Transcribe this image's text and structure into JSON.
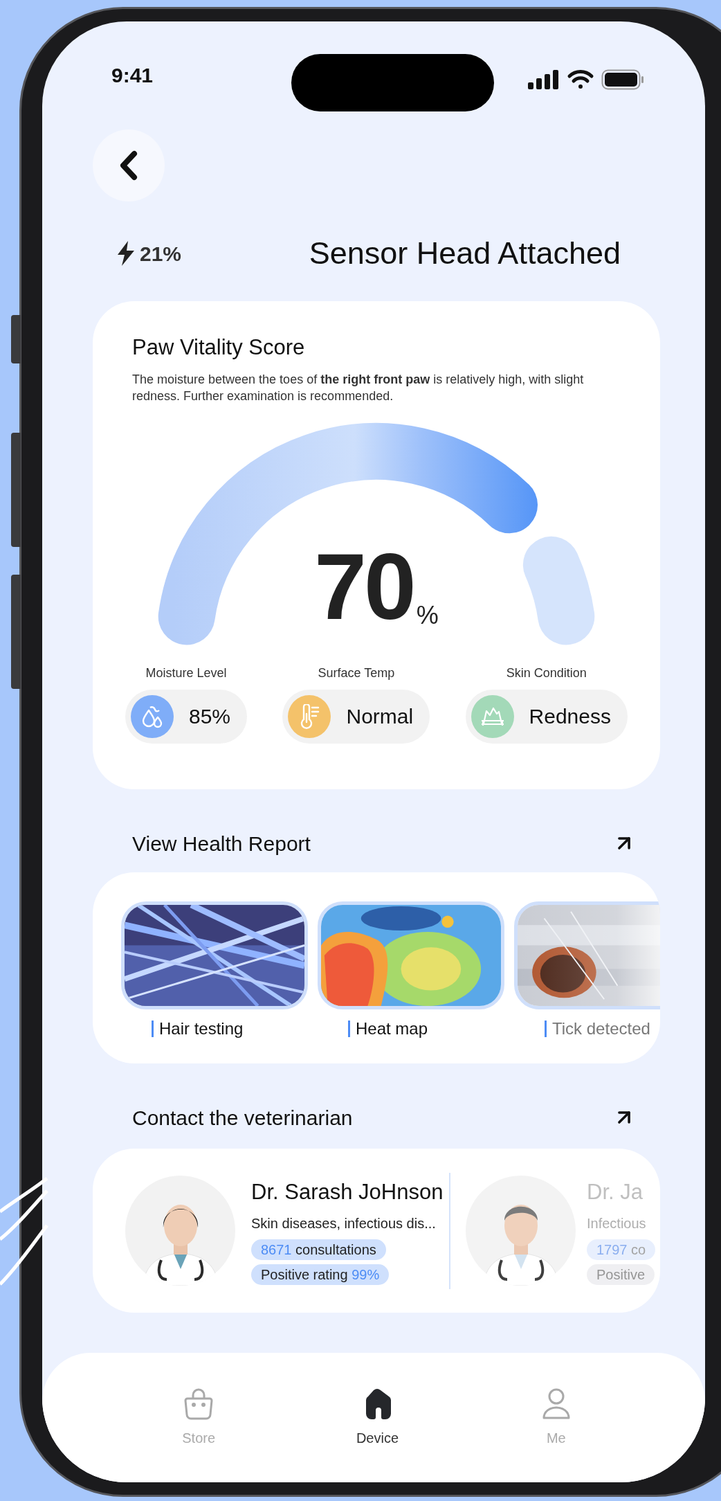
{
  "status_bar": {
    "time": "9:41"
  },
  "header": {
    "battery": "21%",
    "title": "Sensor Head Attached"
  },
  "score_card": {
    "title": "Paw Vitality Score",
    "description": "The moisture between the toes of **the right front paw** is relatively high, with slight redness. Further examination is recommended.",
    "gauge": {
      "level": 0.85,
      "value": "70",
      "unit": "%"
    },
    "metrics": [
      {
        "kind": "moisture",
        "label": "Moisture Level",
        "value": "85%",
        "color": "#7fadf8"
      },
      {
        "kind": "temperature",
        "label": "Surface Temp",
        "value": "Normal",
        "color": "#f4c26a"
      },
      {
        "kind": "skin",
        "label": "Skin Condition",
        "value": "Redness",
        "color": "#a3d9b8"
      }
    ]
  },
  "reports": {
    "title": "View Health Report",
    "items": [
      {
        "label": "Hair testing",
        "kind": "picture"
      },
      {
        "label": "Heat map",
        "kind": "picture"
      },
      {
        "label": "Tick detected",
        "kind": "picture"
      }
    ]
  },
  "vets": {
    "title": "Contact the veterinarian",
    "doctors": [
      {
        "name": "Dr. Sarash JoHnson",
        "specialty": "Skin diseases, infectious dis...",
        "count": "8671",
        "count_label": "consultations",
        "rating_label": "Positive rating",
        "rating_value": "99%",
        "faded": false
      },
      {
        "name": "Dr. Ja",
        "specialty": "Infectious",
        "count": "1797",
        "count_label": "co",
        "rating_label": "Positive",
        "faded": true
      }
    ]
  },
  "tab_bar": [
    {
      "kind": "store",
      "label": "Store",
      "selected": false
    },
    {
      "kind": "device",
      "label": "Device",
      "selected": true
    },
    {
      "kind": "me",
      "label": "Me",
      "selected": false
    }
  ]
}
